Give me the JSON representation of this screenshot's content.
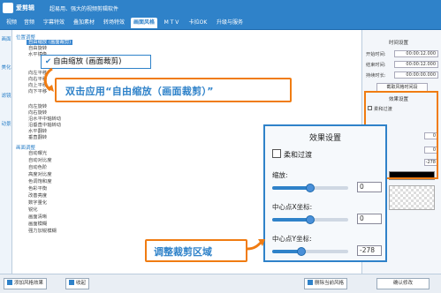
{
  "app": {
    "name": "爱剪辑",
    "slogan": "超易用、强大的视频剪辑软件"
  },
  "menu": [
    {
      "label": "视频"
    },
    {
      "label": "音频"
    },
    {
      "label": "字幕特效"
    },
    {
      "label": "叠加素材"
    },
    {
      "label": "转场特效"
    },
    {
      "label": "画面风格"
    },
    {
      "label": "M T V"
    },
    {
      "label": "卡拉OK"
    },
    {
      "label": "升级与服务"
    }
  ],
  "left_tabs": [
    "画面",
    "美化",
    "滤镜",
    "动景"
  ],
  "tree": {
    "group1": "位置调整",
    "items1": [
      "自由缩放 (画面裁剪)",
      "自由旋转",
      "水平镜像",
      "向左平移",
      "向右平移",
      "向上平移",
      "向下平移",
      "向左旋转",
      "向右旋转",
      "沿水平中轴转动",
      "沿垂直中轴转动",
      "水平翻转",
      "垂直翻转"
    ],
    "group2": "画面调整",
    "items2": [
      "自动曝光",
      "自动对比度",
      "自动色阶",
      "高度对比度",
      "色调饱和度",
      "色彩平衡",
      "改善亮度",
      "数字量化",
      "锐化",
      "画面清晰",
      "画面模糊",
      "强力加锐模糊"
    ]
  },
  "selected_callout": "自由缩放 (画面裁剪)",
  "instruction1": "双击应用“自由缩放（画面裁剪）”",
  "instruction2": "调整裁剪区域",
  "right_panel": {
    "time_title": "时间设置",
    "start_label": "开始时间:",
    "start_value": "00:00:12.000",
    "end_label": "结束时间:",
    "end_value": "00:00:12.000",
    "dur_label": "持续时长:",
    "dur_value": "00:00:00.000",
    "get_time_btn": "截取风格时间段",
    "effect_title": "效果设置",
    "soft_label": "柔和过渡",
    "small_values": [
      "0",
      "0",
      "-278"
    ]
  },
  "zoom_panel": {
    "title": "效果设置",
    "soft_label": "柔和过渡",
    "zoom_label": "缩放:",
    "zoom_value": "0",
    "cx_label": "中心点X坐标:",
    "cx_value": "0",
    "cy_label": "中心点Y坐标:",
    "cy_value": "-278",
    "zoom_level": 0.5,
    "cx_level": 0.5,
    "cy_level": 0.38
  },
  "bottom": {
    "add_btn": "添加风格效果",
    "collapse_btn": "收起",
    "delete_btn": "删除当前风格",
    "confirm_btn": "确认修改"
  }
}
